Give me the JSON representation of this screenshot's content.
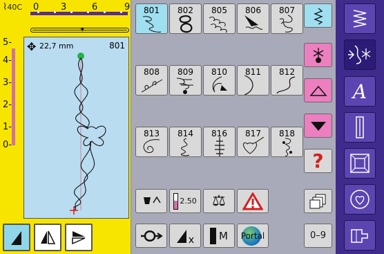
{
  "status": {
    "tension_label": "40C",
    "stitch_width_value": "22,7 mm",
    "pattern_number": "801"
  },
  "top_scale": {
    "labels": [
      "0",
      "3",
      "6",
      "9"
    ]
  },
  "side_scale": {
    "labels": [
      "5-",
      "4-",
      "3-",
      "2-",
      "1-",
      "0-"
    ]
  },
  "patterns": [
    {
      "number": "801",
      "selected": true
    },
    {
      "number": "802",
      "selected": false
    },
    {
      "number": "805",
      "selected": false
    },
    {
      "number": "806",
      "selected": false
    },
    {
      "number": "807",
      "selected": false
    },
    {
      "number": "808",
      "selected": false
    },
    {
      "number": "809",
      "selected": false
    },
    {
      "number": "810",
      "selected": false
    },
    {
      "number": "811",
      "selected": false
    },
    {
      "number": "812",
      "selected": false
    },
    {
      "number": "813",
      "selected": false
    },
    {
      "number": "814",
      "selected": false
    },
    {
      "number": "816",
      "selected": false
    },
    {
      "number": "817",
      "selected": false
    },
    {
      "number": "818",
      "selected": false
    }
  ],
  "tools": {
    "stitch_length_value": "2.50",
    "mirror_m_label": "M",
    "portal_label": "Portal",
    "numeric_label": "0–9"
  },
  "colors": {
    "panel_yellow": "#f7e500",
    "preview_blue": "#b9dcf0",
    "selected_cyan": "#9fdff0",
    "menu_purple": "#3f2b8c",
    "pink": "#ec7fc0",
    "help_red": "#d51f1f"
  },
  "icons": {
    "right_menu": [
      "practical-stitch-icon",
      "decorative-stitch-icon",
      "alphabet-icon",
      "buttonhole-icon",
      "quilt-icon",
      "personal-program-icon",
      "sewing-foot-icon"
    ]
  }
}
